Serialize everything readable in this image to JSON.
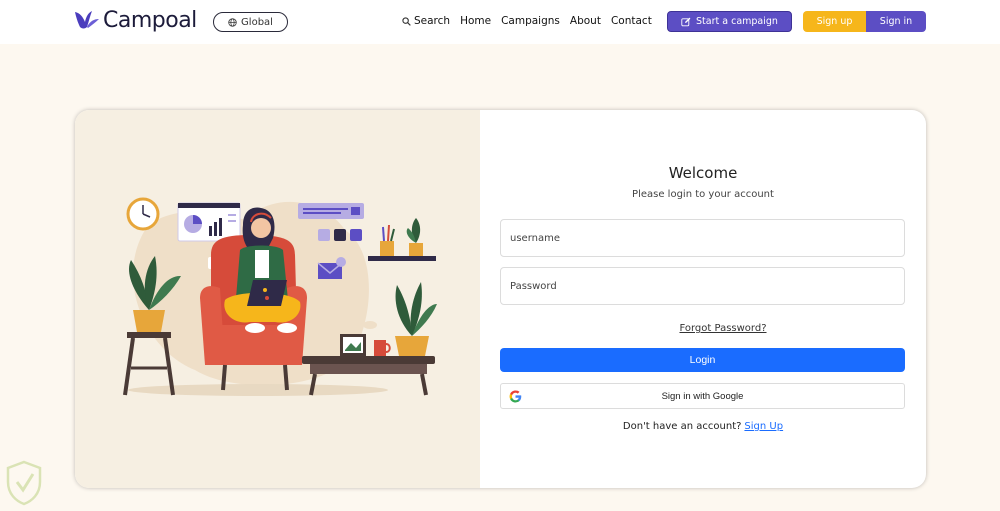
{
  "brand": {
    "name": "Campoal",
    "logo_color": "#5c4ec4"
  },
  "header": {
    "global_label": "Global",
    "nav": [
      {
        "label": "Search",
        "icon": "search-icon"
      },
      {
        "label": "Home"
      },
      {
        "label": "Campaigns"
      },
      {
        "label": "About"
      },
      {
        "label": "Contact"
      }
    ],
    "start_campaign_label": "Start a campaign",
    "signup_label": "Sign up",
    "signin_label": "Sign in"
  },
  "login": {
    "title": "Welcome",
    "subtitle": "Please login to your account",
    "username_placeholder": "username",
    "password_placeholder": "Password",
    "forgot_label": "Forgot Password?",
    "login_label": "Login",
    "google_label": "Sign in with Google",
    "no_account_text": "Don't have an account?",
    "signup_link": "Sign Up"
  },
  "colors": {
    "accent": "#5c4ec4",
    "signup_yellow": "#f6b61b",
    "login_blue": "#1a6cff",
    "page_bg": "#fdf8f0",
    "illustration_bg": "#f6efe2"
  }
}
